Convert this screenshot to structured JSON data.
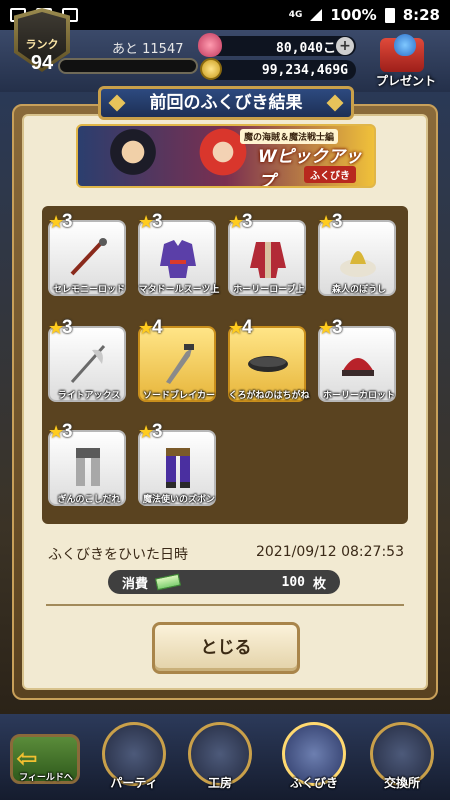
{
  "status_bar": {
    "network": "4G",
    "battery": "100%",
    "time": "8:28"
  },
  "hud": {
    "rank_label": "ランク",
    "rank_value": "94",
    "exp_remaining": "あと 11547",
    "gems": "80,040こ",
    "gold": "99,234,469G",
    "present_label": "プレゼント"
  },
  "dialog": {
    "title": "前回のふくびき結果",
    "banner": {
      "subtitle": "魔の海賊＆魔法戦士編",
      "main": "Wピックアップ",
      "small": "ふくびき"
    },
    "items": [
      {
        "rarity": "3",
        "name": "セレモニーロッド",
        "icon": "rod-icon",
        "gold": false
      },
      {
        "rarity": "3",
        "name": "マタドールスーツ上",
        "icon": "suit-icon",
        "gold": false
      },
      {
        "rarity": "3",
        "name": "ホーリーローブ上",
        "icon": "robe-icon",
        "gold": false
      },
      {
        "rarity": "3",
        "name": "森人のぼうし",
        "icon": "hat-icon",
        "gold": false
      },
      {
        "rarity": "3",
        "name": "ライトアックス",
        "icon": "axe-icon",
        "gold": false
      },
      {
        "rarity": "4",
        "name": "ソードブレイカー",
        "icon": "sword-icon",
        "gold": true
      },
      {
        "rarity": "4",
        "name": "くろがねのはちがね",
        "icon": "headband-icon",
        "gold": true
      },
      {
        "rarity": "3",
        "name": "ホーリーカロット",
        "icon": "cap-icon",
        "gold": false
      },
      {
        "rarity": "3",
        "name": "ぎんのこしだれ",
        "icon": "greaves-icon",
        "gold": false
      },
      {
        "rarity": "3",
        "name": "魔法使いのズボン",
        "icon": "pants-icon",
        "gold": false
      }
    ],
    "date_label": "ふくびきをひいた日時",
    "date_value": "2021/09/12 08:27:53",
    "consume_label": "消費",
    "consume_count": "100",
    "consume_unit": "枚",
    "close_label": "とじる"
  },
  "bottom_nav": {
    "field": "フィールドへ",
    "party": "パーティ",
    "kobo": "工房",
    "fukubiki": "ふくびき",
    "exchange": "交換所"
  }
}
